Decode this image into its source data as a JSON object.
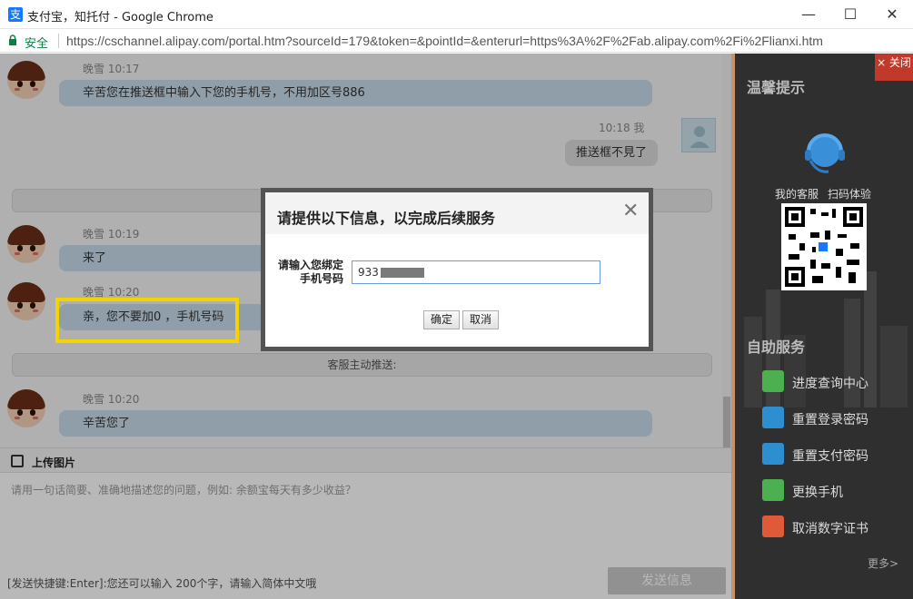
{
  "window": {
    "title": "支付宝，知托付 - Google Chrome",
    "app_icon": "支",
    "minimize": "—",
    "maximize": "☐",
    "close": "✕"
  },
  "address_bar": {
    "secure_label": "安全",
    "url": "https://cschannel.alipay.com/portal.htm?sourceId=179&token=&pointId=&enterurl=https%3A%2F%2Fab.alipay.com%2Fi%2Flianxi.htm"
  },
  "chat": {
    "messages": [
      {
        "sender": "晚雪",
        "time": "10:17",
        "text": "辛苦您在推送框中输入下您的手机号，不用加区号886",
        "from_me": false
      },
      {
        "sender": "我",
        "time": "10:18",
        "text": "推送框不見了",
        "from_me": true
      },
      {
        "sender": "晚雪",
        "time": "10:19",
        "text": "来了",
        "from_me": false
      },
      {
        "sender": "晚雪",
        "time": "10:20",
        "text": "亲，您不要加0 ，手机号码",
        "from_me": false
      },
      {
        "sender": "晚雪",
        "time": "10:20",
        "text": "辛苦您了",
        "from_me": false
      }
    ],
    "meta": {
      "m1": "晚雪 10:17",
      "m2": "10:18 我",
      "m3": "晚雪 10:19",
      "m4": "晚雪 10:20",
      "m5": "晚雪 10:20"
    },
    "system_push_label": "客服主动推送:"
  },
  "composer": {
    "upload_label": "上传图片",
    "placeholder": "请用一句话简要、准确地描述您的问题，例如: 余额宝每天有多少收益？",
    "hint": "[发送快捷键:Enter]:您还可以输入 200个字，请输入简体中文哦",
    "send_label": "发送信息"
  },
  "right_panel": {
    "close_label": "× 关闭",
    "tips_title": "温馨提示",
    "my_service_label": "我的客服",
    "scan_label": "扫码体验",
    "self_service_title": "自助服务",
    "services": [
      {
        "label": "进度查询中心",
        "icon": "progress-icon",
        "color": "#4caf50"
      },
      {
        "label": "重置登录密码",
        "icon": "lock-reset-icon",
        "color": "#2d8fd0"
      },
      {
        "label": "重置支付密码",
        "icon": "pay-lock-icon",
        "color": "#2d8fd0"
      },
      {
        "label": "更换手机",
        "icon": "phone-icon",
        "color": "#4caf50"
      },
      {
        "label": "取消数字证书",
        "icon": "certificate-icon",
        "color": "#e05a3a"
      }
    ],
    "more_label": "更多>"
  },
  "modal": {
    "title": "请提供以下信息，以完成后续服务",
    "close_glyph": "✕",
    "field_label_line1": "请输入您绑定",
    "field_label_line2": "手机号码",
    "field_value": "933",
    "ok_label": "确定",
    "cancel_label": "取消"
  },
  "colors": {
    "bubble": "#c7dbe9",
    "highlight": "#f3d400",
    "panel": "#2f2f2f",
    "secure": "#0b8043"
  }
}
